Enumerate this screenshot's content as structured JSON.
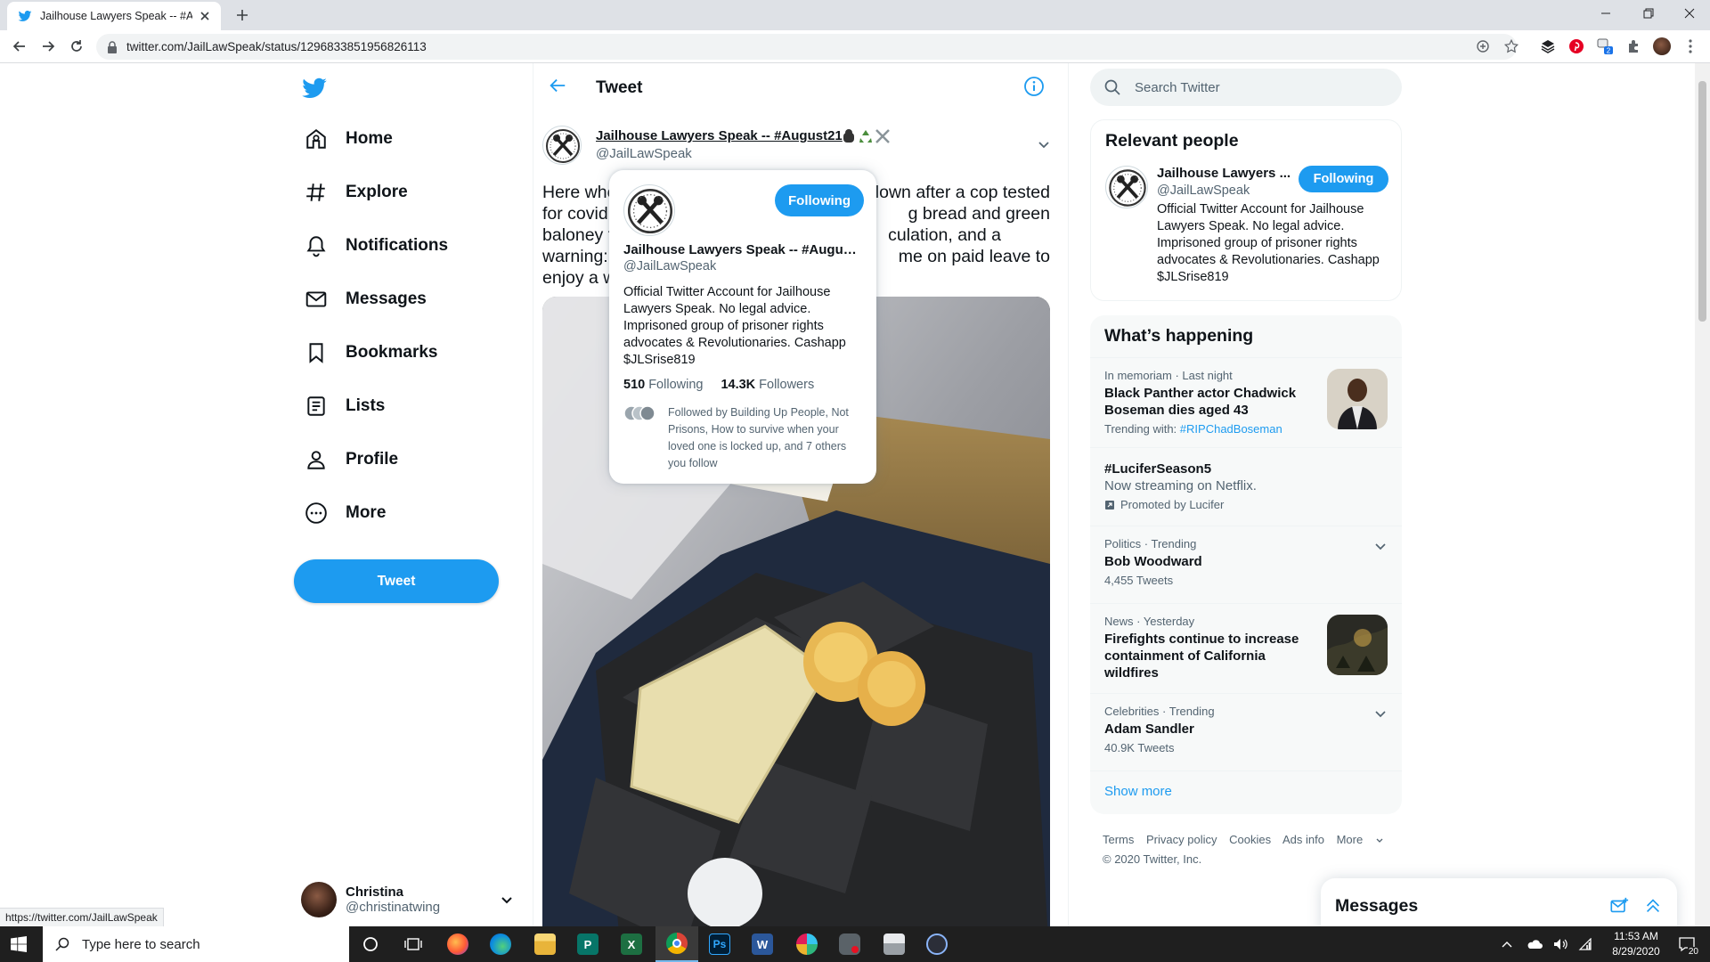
{
  "browser": {
    "tab_title": "Jailhouse Lawyers Speak -- #Aug",
    "url": "twitter.com/JailLawSpeak/status/1296833851956826113",
    "status_url": "https://twitter.com/JailLawSpeak"
  },
  "nav": {
    "items": [
      {
        "label": "Home",
        "icon": "home-icon"
      },
      {
        "label": "Explore",
        "icon": "hashtag-icon"
      },
      {
        "label": "Notifications",
        "icon": "bell-icon"
      },
      {
        "label": "Messages",
        "icon": "envelope-icon"
      },
      {
        "label": "Bookmarks",
        "icon": "bookmark-icon"
      },
      {
        "label": "Lists",
        "icon": "list-icon"
      },
      {
        "label": "Profile",
        "icon": "person-icon"
      },
      {
        "label": "More",
        "icon": "more-circle-icon"
      }
    ],
    "tweet_button": "Tweet"
  },
  "account": {
    "name": "Christina",
    "handle": "@christinatwing"
  },
  "main": {
    "title": "Tweet",
    "tweet": {
      "author_name": "Jailhouse Lawyers Speak -- #August21",
      "author_handle": "@JailLawSpeak",
      "text_line1_a": "Here whe",
      "text_line1_b": "lown after a cop tested",
      "text_line2_a": "for covid.",
      "text_line2_b": "g bread and green",
      "text_line3_a": "baloney f",
      "text_line3_b": "culation, and a",
      "text_line4_a": "warning:",
      "text_line4_b": "me on paid leave to",
      "text_line5_a": "enjoy a w"
    }
  },
  "hovercard": {
    "follow_label": "Following",
    "name": "Jailhouse Lawyers Speak -- #August...",
    "handle": "@JailLawSpeak",
    "bio": "Official Twitter Account for Jailhouse Lawyers Speak. No legal advice. Imprisoned group of prisoner rights advocates & Revolutionaries. Cashapp $JLSrise819",
    "following_count": "510",
    "following_label": "Following",
    "followers_count": "14.3K",
    "followers_label": "Followers",
    "followed_by": "Followed by Building Up People, Not Prisons, How to survive when your loved one is locked up, and 7 others you follow"
  },
  "search": {
    "placeholder": "Search Twitter"
  },
  "relevant": {
    "title": "Relevant people",
    "name": "Jailhouse Lawyers ...",
    "handle": "@JailLawSpeak",
    "follow_label": "Following",
    "bio": "Official Twitter Account for Jailhouse Lawyers Speak. No legal advice. Imprisoned group of prisoner rights advocates & Revolutionaries. Cashapp $JLSrise819"
  },
  "happening": {
    "title": "What’s happening",
    "trends": [
      {
        "meta": "In memoriam · Last night",
        "title": "Black Panther actor Chadwick Boseman dies aged 43",
        "trending_with_label": "Trending with:",
        "trending_with_tag": "#RIPChadBoseman"
      },
      {
        "title": "#LuciferSeason5",
        "desc": "Now streaming on Netflix.",
        "promoted": "Promoted by Lucifer"
      },
      {
        "meta": "Politics · Trending",
        "title": "Bob Woodward",
        "count": "4,455 Tweets"
      },
      {
        "meta": "News · Yesterday",
        "title": "Firefights continue to increase containment of California wildfires"
      },
      {
        "meta": "Celebrities · Trending",
        "title": "Adam Sandler",
        "count": "40.9K Tweets"
      }
    ],
    "show_more": "Show more"
  },
  "footer": {
    "terms": "Terms",
    "privacy": "Privacy policy",
    "cookies": "Cookies",
    "ads": "Ads info",
    "more": "More",
    "copyright": "© 2020 Twitter, Inc."
  },
  "messages_dock": {
    "title": "Messages"
  },
  "taskbar": {
    "search_placeholder": "Type here to search",
    "time": "11:53 AM",
    "date": "8/29/2020",
    "notif_count": "20"
  },
  "colors": {
    "accent": "#1d9bf0",
    "text": "#0f1419",
    "muted": "#536471"
  }
}
